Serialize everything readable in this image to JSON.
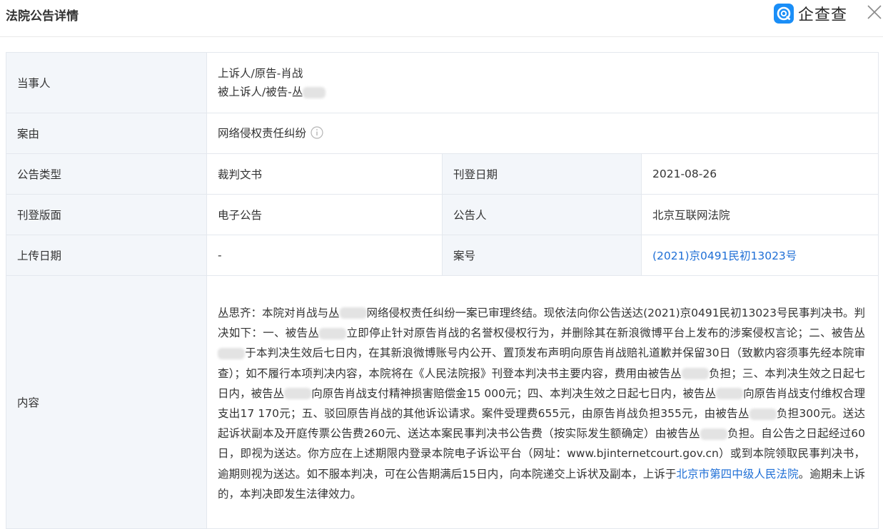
{
  "header": {
    "title": "法院公告详情",
    "brand": "企查查",
    "brand_color": "#1a8ef7",
    "close_icon": "close-icon"
  },
  "rows": {
    "parties": {
      "label": "当事人",
      "appellant": "上诉人/原告-肖战",
      "appellee_prefix": "被上诉人/被告-丛"
    },
    "cause": {
      "label": "案由",
      "value": "网络侵权责任纠纷",
      "icon": "info-icon"
    },
    "notice_type": {
      "label": "公告类型",
      "value": "裁判文书"
    },
    "publish_date": {
      "label": "刊登日期",
      "value": "2021-08-26"
    },
    "layout": {
      "label": "刊登版面",
      "value": "电子公告"
    },
    "announcer": {
      "label": "公告人",
      "value": "北京互联网法院"
    },
    "upload_date": {
      "label": "上传日期",
      "value": "-"
    },
    "case_no": {
      "label": "案号",
      "value": "(2021)京0491民初13023号",
      "color": "#1f6fd6"
    },
    "content": {
      "label": "内容",
      "p1": "丛思齐：本院对肖战与丛",
      "p2": "网络侵权责任纠纷一案已审理终结。现依法向你公告送达(2021)京0491民初13023号民事判决书。判决如下：一、被告丛",
      "p3": "立即停止针对原告肖战的名誉权侵权行为，并删除其在新浪微博平台上发布的涉案侵权言论；二、被告丛",
      "p4": "于本判决生效后七日内，在其新浪微博账号内公开、置顶发布声明向原告肖战赔礼道歉并保留30日（致歉内容须事先经本院审查）；如不履行本项判决内容，本院将在《人民法院报》刊登本判决书主要内容，费用由被告丛",
      "p5": "负担；三、本判决生效之日起七日内，被告丛",
      "p6": "向原告肖战支付精神损害赔偿金15 000元；四、本判决生效之日起七日内，被告丛",
      "p7": "向原告肖战支付维权合理支出17 170元；五、驳回原告肖战的其他诉讼请求。案件受理费655元，由原告肖战负担355元，由被告丛",
      "p8": "负担300元。送达起诉状副本及开庭传票公告费260元、送达本案民事判决书公告费（按实际发生额确定）由被告丛",
      "p9": "负担。自公告之日起经过60日，即视为送达。你方应在上述期限内登录本院电子诉讼平台（网址：www.bjinternetcourt.gov.cn）或到本院领取民事判决书，逾期则视为送达。如不服本判决，可在公告期满后15日内，向本院递交上诉状及副本，上诉于",
      "court_link": "北京市第四中级人民法院",
      "p10": "。逾期未上诉的，本判决即发生法律效力。"
    }
  }
}
